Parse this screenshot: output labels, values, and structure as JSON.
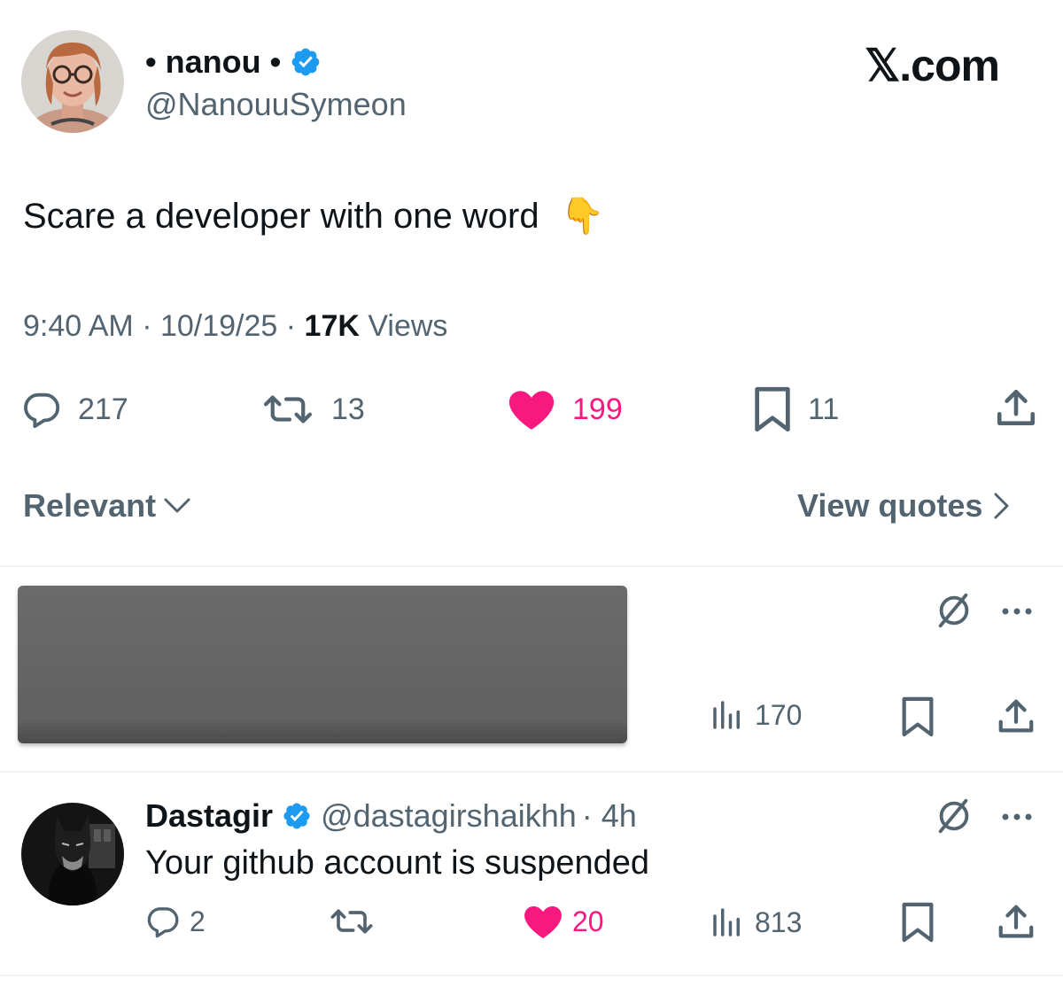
{
  "tweet": {
    "display_name": "• nanou •",
    "handle": "@NanouuSymeon",
    "text": "Scare a developer with one word",
    "emoji": "👇",
    "time": "9:40 AM · 10/19/25 · ",
    "views_count": "17K",
    "views_label": " Views",
    "replies": "217",
    "reposts": "13",
    "likes": "199",
    "bookmarks": "11"
  },
  "brand": "𝕏.com",
  "sort": {
    "label": "Relevant"
  },
  "quotes": {
    "label": "View quotes"
  },
  "hidden_reply": {
    "views": "170"
  },
  "reply": {
    "name": "Dastagir",
    "handle": "@dastagirshaikhh",
    "age": "· 4h",
    "text": "Your github account is suspended",
    "replies": "2",
    "likes": "20",
    "views": "813"
  },
  "colors": {
    "like": "#f91880",
    "verified": "#1d9bf0",
    "muted": "#536471",
    "text": "#0f1419"
  },
  "icons": [
    "verified-badge-icon",
    "reply-icon",
    "repost-icon",
    "heart-icon",
    "bookmark-icon",
    "share-icon",
    "chevron-down-icon",
    "chevron-right-icon",
    "grok-icon",
    "more-icon",
    "views-icon"
  ]
}
